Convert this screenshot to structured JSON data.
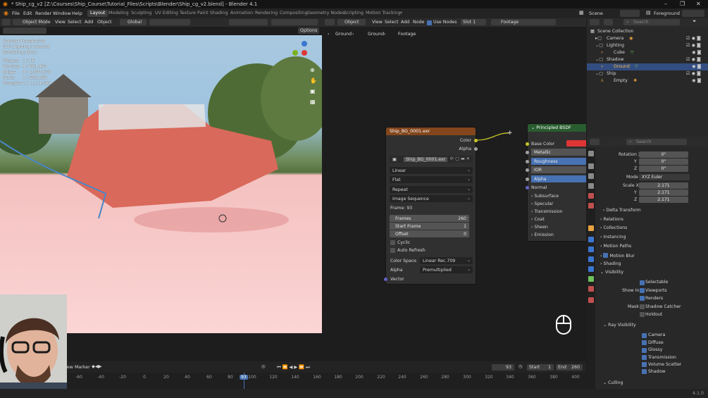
{
  "window": {
    "title": "* Ship_cg_v2 [Z:\\Courses\\Ship_Course\\Tutorial_Files\\Scripts\\Blender\\Ship_cg_v2.blend] - Blender 4.1"
  },
  "menu": [
    "File",
    "Edit",
    "Render",
    "Window",
    "Help"
  ],
  "workspaces": [
    "Layout",
    "Modeling",
    "Sculpting",
    "UV Editing",
    "Texture Paint",
    "Shading",
    "Animation",
    "Rendering",
    "Compositing",
    "Geometry Nodes",
    "Scripting",
    "Motion Tracking"
  ],
  "active_workspace": "Layout",
  "scene": {
    "label": "Scene",
    "view_layer": "Foreground"
  },
  "viewport": {
    "mode": "Object Mode",
    "menus": [
      "View",
      "Select",
      "Add",
      "Object"
    ],
    "orientation": "Global",
    "options_label": "Options",
    "overlay": {
      "camera": "Camera Perspective",
      "collection": "(93) Lighting | Ground",
      "status": "Rendering Done",
      "stats": [
        {
          "label": "Objects",
          "value": "1 / 16"
        },
        {
          "label": "Vertices",
          "value": "4 / 661,487"
        },
        {
          "label": "Edges",
          "value": "4 / 1,097,878"
        },
        {
          "label": "Faces",
          "value": "1 / 558,298"
        },
        {
          "label": "Triangles",
          "value": "2 / 1,114,584"
        }
      ]
    }
  },
  "node_editor": {
    "object_label": "Object",
    "menus": [
      "View",
      "Select",
      "Add",
      "Node"
    ],
    "use_nodes_label": "Use Nodes",
    "slot_label": "Slot 1",
    "material_name": "Footage",
    "breadcrumb": [
      "Ground",
      "Ground",
      "Footage"
    ],
    "image_node": {
      "title": "Ship_BG_0001.exr",
      "outputs": [
        "Color",
        "Alpha"
      ],
      "image_name": "Ship_BG_0001.exr",
      "interpolation": "Linear",
      "projection": "Flat",
      "extension": "Repeat",
      "source": "Image Sequence",
      "frame_text": "Frame: 93",
      "frames": {
        "label": "Frames",
        "value": "260"
      },
      "start_frame": {
        "label": "Start Frame",
        "value": "1"
      },
      "offset": {
        "label": "Offset",
        "value": "0"
      },
      "cyclic_label": "Cyclic",
      "auto_refresh_label": "Auto Refresh",
      "color_space": {
        "label": "Color Space",
        "value": "Linear Rec.709"
      },
      "alpha": {
        "label": "Alpha",
        "value": "Premultiplied"
      },
      "vector_label": "Vector"
    },
    "bsdf_node": {
      "title": "Principled BSDF",
      "inputs": [
        "Base Color",
        "Metallic",
        "Roughness",
        "IOR",
        "Alpha",
        "Normal"
      ],
      "panels": [
        "Subsurface",
        "Specular",
        "Transmission",
        "Coat",
        "Sheen",
        "Emission"
      ],
      "base_color": "#e03535"
    }
  },
  "outliner": {
    "search_placeholder": "Search",
    "rows": [
      {
        "name": "Scene Collection",
        "indent": 0,
        "selected": false
      },
      {
        "name": "Camera",
        "indent": 1,
        "selected": false
      },
      {
        "name": "Lighting",
        "indent": 1,
        "selected": false
      },
      {
        "name": "Cube",
        "indent": 2,
        "selected": false
      },
      {
        "name": "Shadow",
        "indent": 1,
        "selected": false
      },
      {
        "name": "Ground",
        "indent": 2,
        "selected": true
      },
      {
        "name": "Ship",
        "indent": 1,
        "selected": false
      },
      {
        "name": "Empty",
        "indent": 2,
        "selected": false
      }
    ]
  },
  "properties": {
    "search_placeholder": "Search",
    "rotation": {
      "label_x": "Rotation X",
      "label_y": "Y",
      "label_z": "Z",
      "x": "0°",
      "y": "0°",
      "z": "0°"
    },
    "mode": {
      "label": "Mode",
      "value": "XYZ Euler"
    },
    "scale": {
      "label_x": "Scale X",
      "label_y": "Y",
      "label_z": "Z",
      "x": "2.171",
      "y": "2.171",
      "z": "2.171"
    },
    "sections": [
      "Delta Transform",
      "Relations",
      "Collections",
      "Instancing",
      "Motion Paths",
      "Motion Blur",
      "Shading",
      "Visibility"
    ],
    "visibility": {
      "selectable": "Selectable",
      "show_in_label": "Show In",
      "viewports": "Viewports",
      "renders": "Renders",
      "mask_label": "Mask",
      "shadow_catcher": "Shadow Catcher",
      "holdout": "Holdout"
    },
    "ray_visibility": {
      "title": "Ray Visibility",
      "items": [
        "Camera",
        "Diffuse",
        "Glossy",
        "Transmission",
        "Volume Scatter",
        "Shadow"
      ]
    },
    "culling_label": "Culling"
  },
  "timeline": {
    "menus": [
      "View",
      "Marker"
    ],
    "current_frame": "93",
    "start": {
      "label": "Start",
      "value": "1"
    },
    "end": {
      "label": "End",
      "value": "260"
    },
    "ticks": [
      "-60",
      "-40",
      "-20",
      "0",
      "20",
      "40",
      "60",
      "80",
      "93",
      "100",
      "120",
      "140",
      "160",
      "180",
      "200",
      "220",
      "240",
      "260",
      "280",
      "300",
      "320",
      "340",
      "360",
      "380",
      "400"
    ]
  },
  "status": {
    "version": "4.1.0"
  },
  "colors": {
    "accent": "#4772b3",
    "image_node_header": "#83461c",
    "shader_node_header": "#295c2e",
    "selection": "#334d80"
  }
}
